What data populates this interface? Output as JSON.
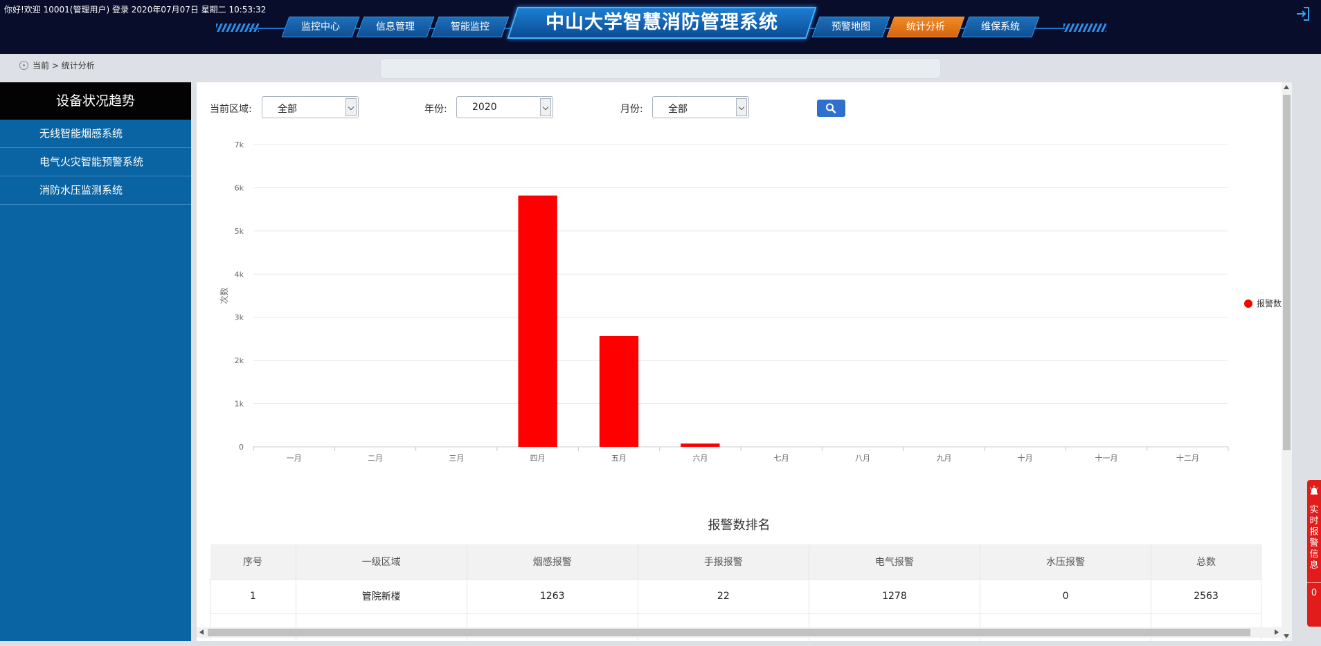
{
  "header": {
    "welcome": "你好!欢迎 10001(管理用户) 登录 2020年07月07日 星期二 10:53:32",
    "title": "中山大学智慧消防管理系统",
    "nav": [
      "监控中心",
      "信息管理",
      "智能监控",
      "预警地图",
      "统计分析",
      "维保系统"
    ],
    "active_nav": "统计分析",
    "logout_icon": "logout-icon"
  },
  "breadcrumb": {
    "text": "当前 > 统计分析"
  },
  "sidebar": {
    "title": "设备状况趋势",
    "items": [
      "无线智能烟感系统",
      "电气火灾智能预警系统",
      "消防水压监测系统"
    ]
  },
  "filters": {
    "region_label": "当前区域:",
    "region_value": "全部",
    "year_label": "年份:",
    "year_value": "2020",
    "month_label": "月份:",
    "month_value": "全部",
    "search_icon": "search-icon"
  },
  "chart_data": {
    "type": "bar",
    "categories": [
      "一月",
      "二月",
      "三月",
      "四月",
      "五月",
      "六月",
      "七月",
      "八月",
      "九月",
      "十月",
      "十一月",
      "十二月"
    ],
    "series": [
      {
        "name": "报警数",
        "values": [
          0,
          0,
          0,
          5820,
          2563,
          75,
          0,
          0,
          0,
          0,
          0,
          0
        ]
      }
    ],
    "ylabel": "次数",
    "yticks": [
      "0",
      "1k",
      "2k",
      "3k",
      "4k",
      "5k",
      "6k",
      "7k"
    ],
    "ylim": [
      0,
      7000
    ],
    "legend_placement": "right",
    "grid": true,
    "bar_color": "#ff0000"
  },
  "ranking": {
    "title": "报警数排名",
    "columns": [
      "序号",
      "一级区域",
      "烟感报警",
      "手报报警",
      "电气报警",
      "水压报警",
      "总数"
    ],
    "rows": [
      [
        "1",
        "管院新楼",
        "1263",
        "22",
        "1278",
        "0",
        "2563"
      ]
    ]
  },
  "alarm_tab": {
    "label": "实时报警信息",
    "count": "0",
    "bell_icon": "alarm-bell-icon"
  },
  "colors": {
    "topbar": "#080d2b",
    "nav_blue": "#1d6fba",
    "nav_active": "#f28a25",
    "sidebar": "#0a64a3",
    "alarm": "#e21b1b",
    "search_button": "#2f6fd0"
  }
}
